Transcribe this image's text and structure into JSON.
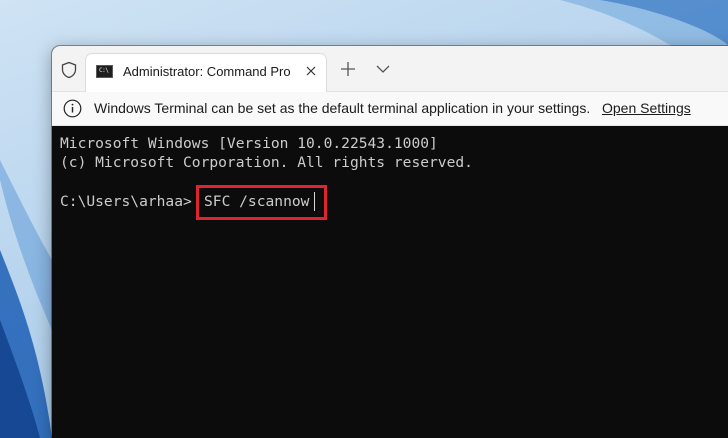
{
  "tab": {
    "title": "Administrator: Command Promp",
    "icon": "command-prompt-icon"
  },
  "infobar": {
    "message": "Windows Terminal can be set as the default terminal application in your settings.",
    "link": "Open Settings",
    "icon": "info-icon"
  },
  "console": {
    "lines": [
      "Microsoft Windows [Version 10.0.22543.1000]",
      "(c) Microsoft Corporation. All rights reserved."
    ],
    "prompt": "C:\\Users\\arhaa>",
    "command": "SFC /scannow"
  },
  "colors": {
    "highlight": "#e0242f",
    "console_bg": "#0c0c0c",
    "console_text": "#cccccc"
  }
}
